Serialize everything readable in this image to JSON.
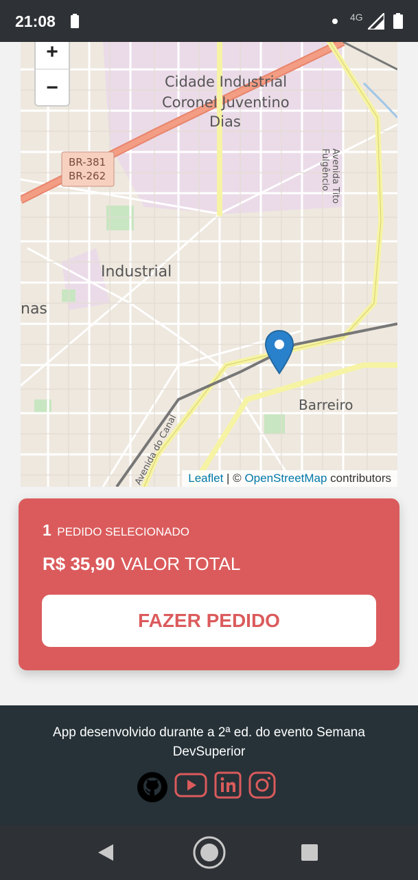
{
  "status_bar": {
    "time": "21:08",
    "network": "4G"
  },
  "map": {
    "zoom_in": "+",
    "zoom_out": "−",
    "labels": {
      "district_1": "Cidade Industrial",
      "district_2": "Coronel Juventino",
      "district_3": "Dias",
      "industrial": "Industrial",
      "barreiro": "Barreiro",
      "partial": "nas",
      "road_1": "BR-381",
      "road_2": "BR-262",
      "avenue_1": "Avenida Tito Fulgêncio",
      "avenue_2": "Avenida do Canal"
    },
    "attribution": {
      "leaflet": "Leaflet",
      "separator": " | © ",
      "osm": "OpenStreetMap",
      "suffix": " contributors"
    }
  },
  "summary": {
    "order_count": "1",
    "order_label": "PEDIDO SELECIONADO",
    "total_amount": "R$ 35,90",
    "total_label": "VALOR TOTAL",
    "button_label": "FAZER PEDIDO"
  },
  "footer": {
    "text": "App desenvolvido durante a 2ª ed. do evento Semana DevSuperior",
    "icons": [
      "github-icon",
      "youtube-icon",
      "linkedin-icon",
      "instagram-icon"
    ]
  },
  "colors": {
    "accent": "#db5b5c",
    "footer_bg": "#263238",
    "status_bg": "#2e3135",
    "map_bg": "#eee8df"
  }
}
